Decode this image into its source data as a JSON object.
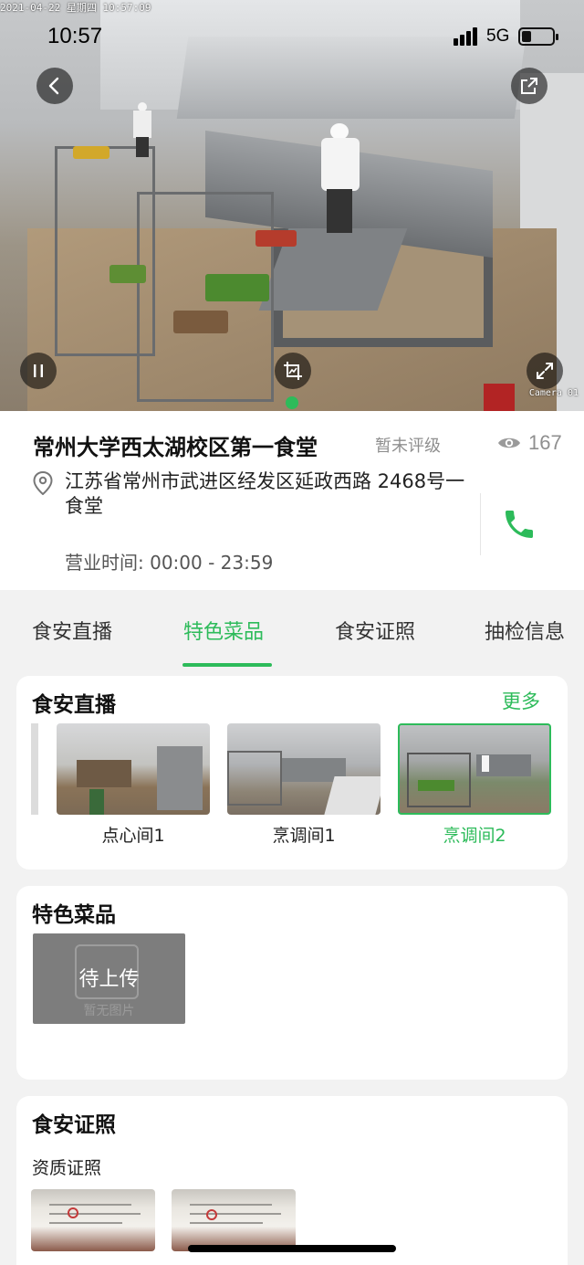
{
  "osd": {
    "datetime": "2021-04-22 星期四 10:57:09",
    "camera": "Camera 01"
  },
  "status_bar": {
    "time": "10:57",
    "network": "5G"
  },
  "icons": {
    "back": "chevron-left-icon",
    "share": "share-icon",
    "pause": "pause-icon",
    "snapshot": "image-crop-icon",
    "fullscreen": "expand-icon",
    "views": "eye-icon",
    "location": "location-pin-icon",
    "phone": "phone-icon"
  },
  "colors": {
    "accent": "#2dbb5a",
    "muted": "#8f8f8f",
    "background": "#f2f2f2"
  },
  "canteen": {
    "name": "常州大学西太湖校区第一食堂",
    "rating": "暂未评级",
    "views": "167",
    "address": "江苏省常州市武进区经发区延政西路 2468号一食堂",
    "hours": "营业时间: 00:00 - 23:59"
  },
  "tabs": [
    {
      "label": "食安直播"
    },
    {
      "label": "特色菜品"
    },
    {
      "label": "食安证照"
    },
    {
      "label": "抽检信息"
    }
  ],
  "live": {
    "title": "食安直播",
    "more": "更多",
    "cameras": [
      {
        "label": "点心间1"
      },
      {
        "label": "烹调间1"
      },
      {
        "label": "烹调间2"
      }
    ]
  },
  "dishes": {
    "title": "特色菜品",
    "status": "待上传",
    "empty_text": "暂无图片"
  },
  "certs": {
    "title": "食安证照",
    "subtitle": "资质证照"
  }
}
